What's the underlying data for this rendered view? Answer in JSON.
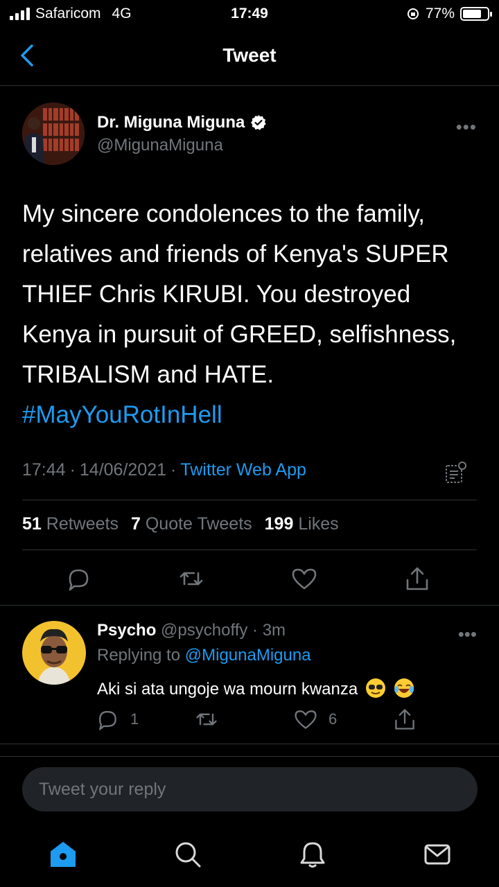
{
  "status_bar": {
    "carrier": "Safaricom",
    "network": "4G",
    "time": "17:49",
    "battery": "77%",
    "battery_level": 0.77
  },
  "header": {
    "title": "Tweet",
    "back_icon": "chevron-left-icon"
  },
  "tweet": {
    "author_name": "Dr. Miguna Miguna",
    "author_handle": "@MigunaMiguna",
    "verified": true,
    "text": "My sincere condolences to the family, relatives and friends of Kenya's SUPER THIEF Chris KIRUBI. You destroyed Kenya in pursuit of GREED, selfishness, TRIBALISM and HATE.",
    "hashtag": "#MayYouRotInHell",
    "time": "17:44",
    "date": "14/06/2021",
    "source": "Twitter Web App",
    "stats": {
      "retweets_count": "51",
      "retweets_label": "Retweets",
      "quotes_count": "7",
      "quotes_label": "Quote Tweets",
      "likes_count": "199",
      "likes_label": "Likes"
    }
  },
  "reply": {
    "name": "Psycho",
    "handle": "@psychoffy",
    "age": "3m",
    "replying_label": "Replying to",
    "replying_handle": "@MigunaMiguna",
    "text": "Aki si ata ungoje wa mourn kwanza",
    "reply_count": "1",
    "like_count": "6"
  },
  "composer": {
    "placeholder": "Tweet your reply"
  },
  "tabs": [
    "home-icon",
    "search-icon",
    "notifications-icon",
    "messages-icon"
  ],
  "colors": {
    "accent": "#1d9bf0",
    "background": "#000000",
    "muted": "#71767b"
  }
}
